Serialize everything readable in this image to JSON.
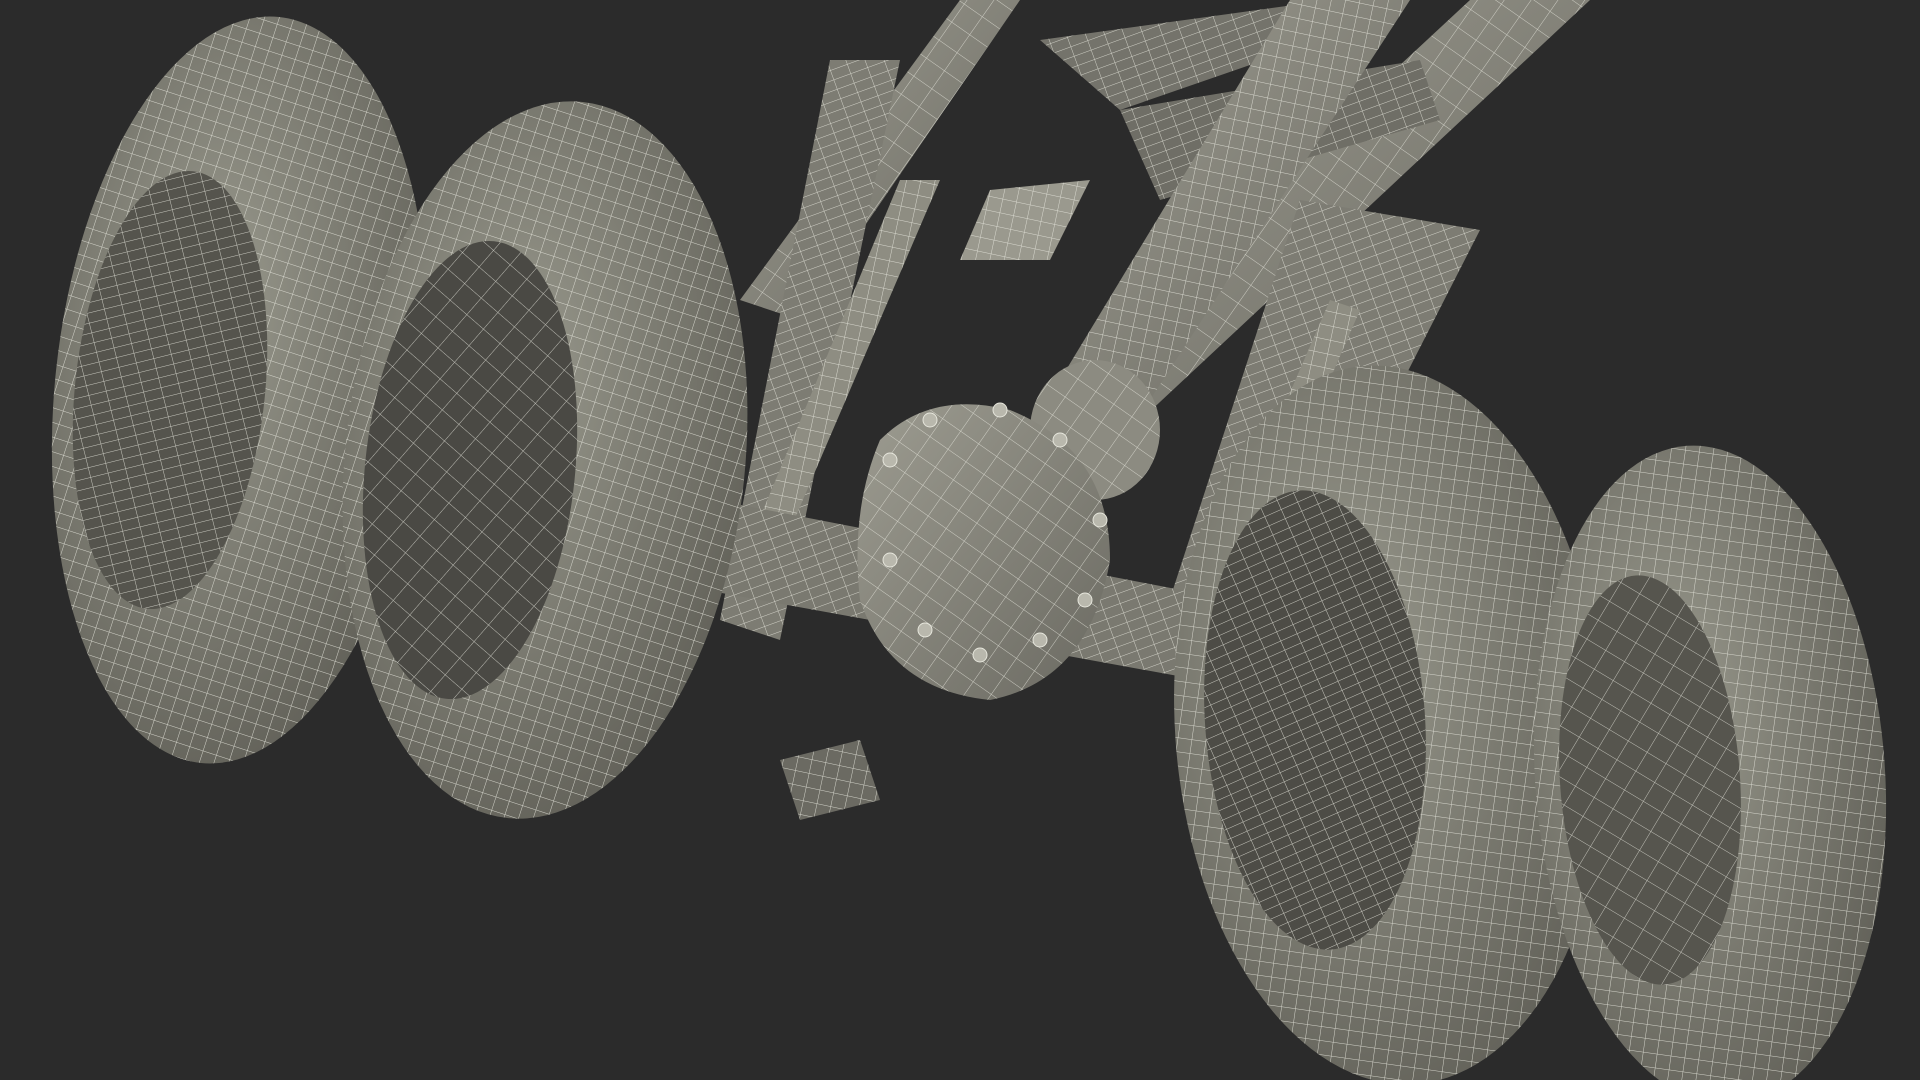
{
  "scene": {
    "background": "#2b2b2b",
    "model_fill": "#8b8a7f",
    "model_shadow": "#5e5d55",
    "model_dark": "#454540",
    "wire_color": "#e6e6dc",
    "components": [
      "tire-outer-left-icon",
      "tire-inner-left-icon",
      "tire-inner-right-icon",
      "tire-outer-right-icon",
      "differential-housing-icon",
      "driveshaft-icon",
      "frame-rail-icon",
      "leaf-spring-icon",
      "shock-absorber-icon",
      "axle-tube-icon"
    ]
  }
}
